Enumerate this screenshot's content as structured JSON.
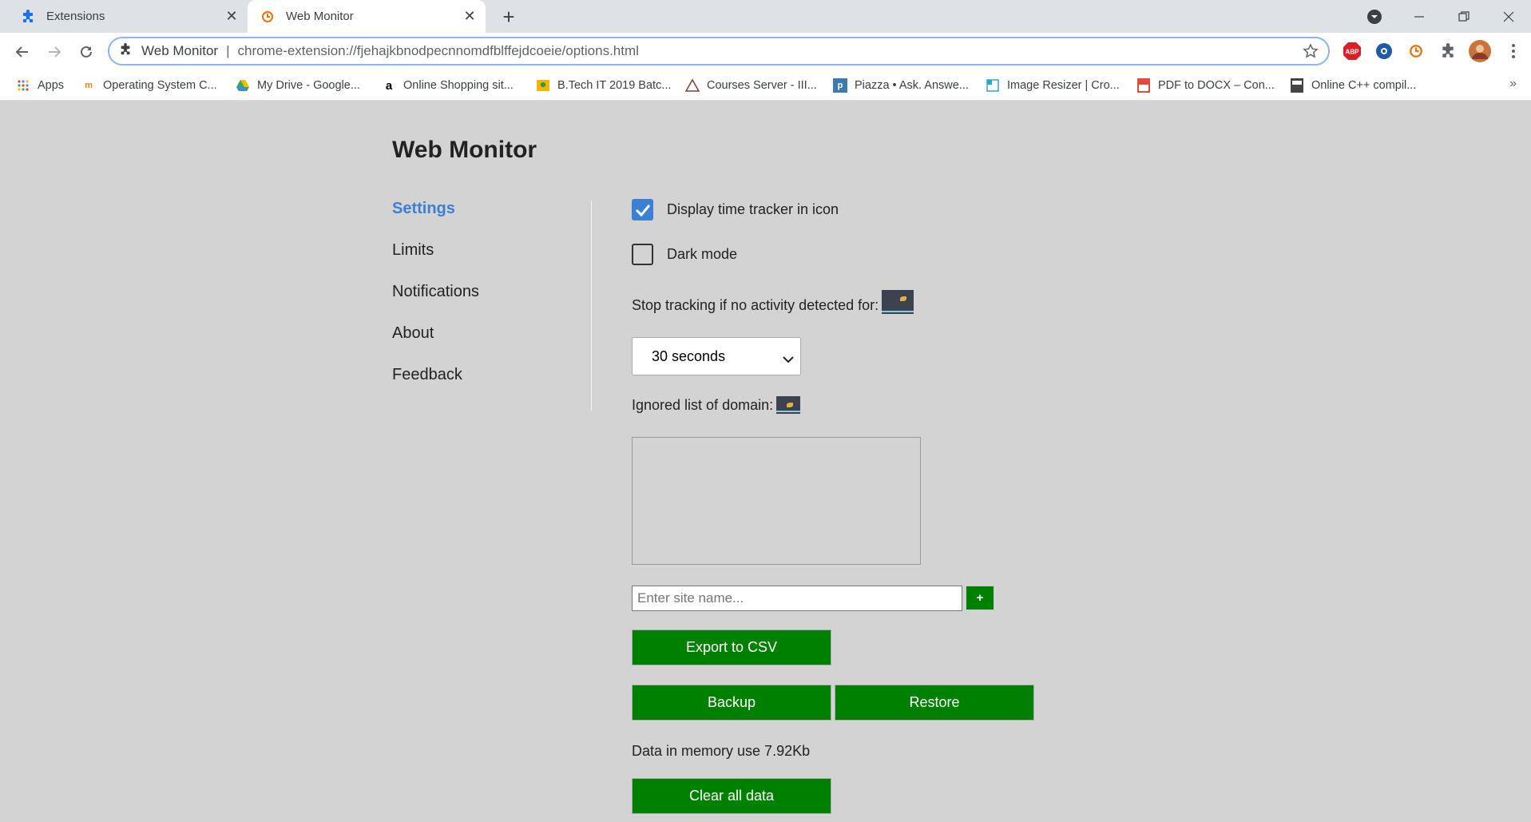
{
  "browser": {
    "tabs": [
      {
        "title": "Extensions",
        "active": false
      },
      {
        "title": "Web Monitor",
        "active": true
      }
    ],
    "omnibox": {
      "site_chip": "Web Monitor",
      "separator": "|",
      "url": "chrome-extension://fjehajkbnodpecnnomdfblffejdcoeie/options.html"
    },
    "extensions": [
      "abp-icon",
      "privacy-icon",
      "web-monitor-icon",
      "puzzle-icon",
      "avatar"
    ],
    "abp_label": "ABP",
    "bookmarks": [
      {
        "label": "Apps",
        "icon": "apps-grid-icon"
      },
      {
        "label": "Operating System C...",
        "icon": "moodle-icon"
      },
      {
        "label": "My Drive - Google...",
        "icon": "drive-icon"
      },
      {
        "label": "Online Shopping sit...",
        "icon": "amazon-icon"
      },
      {
        "label": "B.Tech IT 2019 Batc...",
        "icon": "classroom-icon"
      },
      {
        "label": "Courses Server - III...",
        "icon": "courses-icon"
      },
      {
        "label": "Piazza • Ask. Answe...",
        "icon": "piazza-icon"
      },
      {
        "label": "Image Resizer | Cro...",
        "icon": "resizer-icon"
      },
      {
        "label": "PDF to DOCX – Con...",
        "icon": "pdf-icon"
      },
      {
        "label": "Online C++ compil...",
        "icon": "ide-icon"
      }
    ],
    "bookmarks_overflow": "»"
  },
  "page": {
    "title": "Web Monitor",
    "nav": [
      {
        "label": "Settings",
        "selected": true
      },
      {
        "label": "Limits",
        "selected": false
      },
      {
        "label": "Notifications",
        "selected": false
      },
      {
        "label": "About",
        "selected": false
      },
      {
        "label": "Feedback",
        "selected": false
      }
    ],
    "settings": {
      "display_tracker": {
        "label": "Display time tracker in icon",
        "checked": true
      },
      "dark_mode": {
        "label": "Dark mode",
        "checked": false
      },
      "stop_tracking_label": "Stop tracking if no activity detected for:",
      "inactivity_select": {
        "value": "30 seconds"
      },
      "ignored_label": "Ignored list of domain:",
      "ignored_domains": [],
      "site_input_placeholder": "Enter site name...",
      "add_button": "+",
      "export_button": "Export to CSV",
      "backup_button": "Backup",
      "restore_button": "Restore",
      "memory_text": "Data in memory use 7.92Kb",
      "clear_button": "Clear all data"
    }
  },
  "colors": {
    "accent": "#3b7fd6",
    "button_green": "#008000",
    "page_bg": "#d3d3d3"
  }
}
